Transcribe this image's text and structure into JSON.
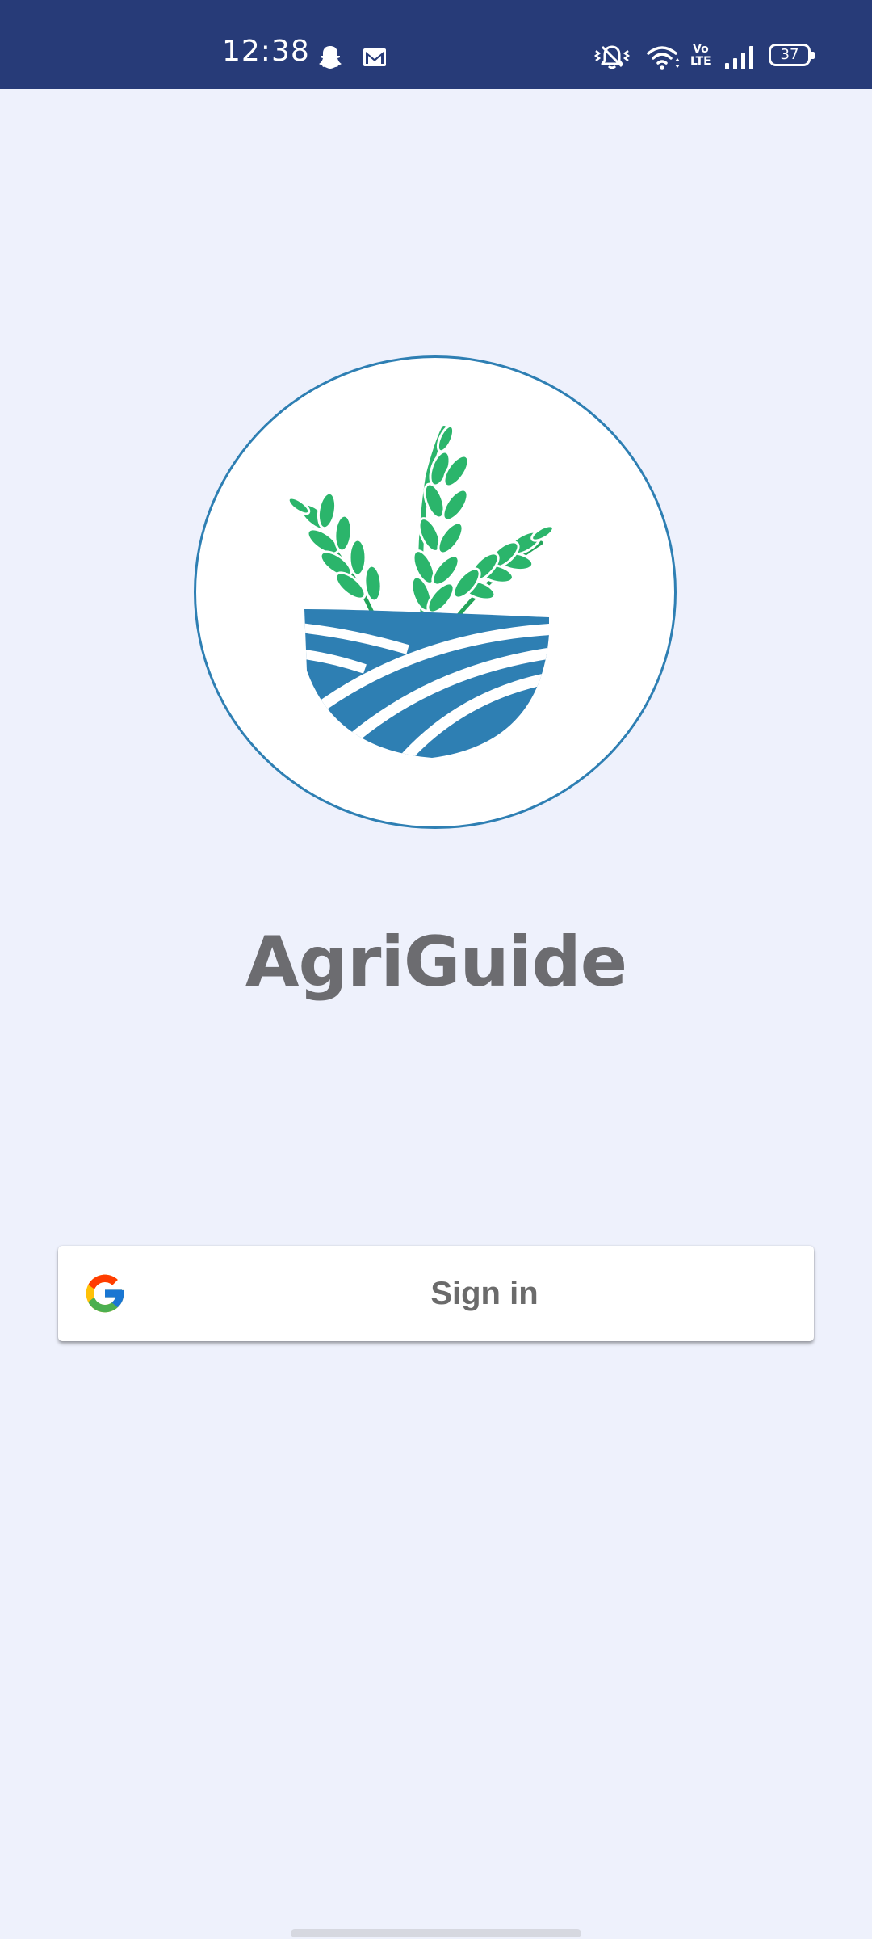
{
  "status_bar": {
    "time": "12:38",
    "notification_icons": [
      "snapchat-icon",
      "gmail-icon"
    ],
    "system_icons": [
      "vibrate-icon",
      "wifi-icon",
      "volte-icon",
      "cell-signal-icon",
      "battery-icon"
    ],
    "volte_top": "Vo",
    "volte_bottom": "LTE",
    "battery_level": "37",
    "background_color": "#273b78"
  },
  "logo": {
    "name": "agriguide-logo",
    "accent_blue": "#2e7fb3",
    "accent_green": "#27ae60"
  },
  "app": {
    "title": "AgriGuide",
    "title_color": "#6c6c70"
  },
  "signin": {
    "label": "Sign in",
    "icon": "google-g-icon"
  },
  "colors": {
    "background": "#eef1fc"
  }
}
